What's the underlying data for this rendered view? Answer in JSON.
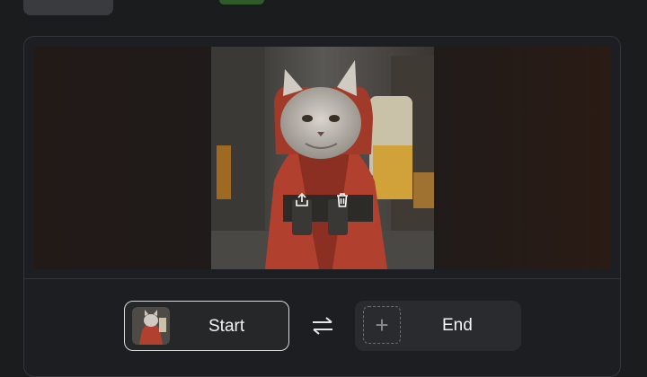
{
  "top": {},
  "preview": {
    "actions": [
      {
        "icon": "share-icon"
      },
      {
        "icon": "trash-icon"
      }
    ]
  },
  "frames": {
    "start_label": "Start",
    "end_label": "End",
    "add_symbol": "+",
    "swap_icon": "swap-icon"
  }
}
